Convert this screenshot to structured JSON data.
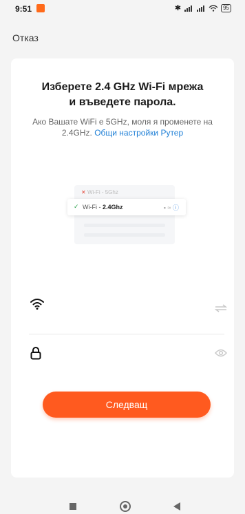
{
  "status_bar": {
    "time": "9:51",
    "battery": "95",
    "icons": [
      "bluetooth-icon",
      "signal-icon",
      "signal-icon",
      "wifi-icon",
      "battery-icon"
    ]
  },
  "header": {
    "cancel_label": "Отказ"
  },
  "card": {
    "title_line1": "Изберете 2.4 GHz Wi-Fi мрежа",
    "title_line2": "и въведете парола.",
    "subtitle_text": "Ако Вашате WiFi е 5GHz, моля я променете на 2.4GHz. ",
    "subtitle_link": "Общи настройки Рутер"
  },
  "illustration": {
    "row1_prefix": "Wi-Fi - ",
    "row1_band": "5Ghz",
    "row2_prefix": "Wi-Fi - ",
    "row2_band": "2.4Ghz"
  },
  "form": {
    "wifi_icon": "wifi-icon",
    "swap_icon": "swap-icon",
    "lock_icon": "lock-icon",
    "eye_icon": "eye-icon"
  },
  "buttons": {
    "next_label": "Следващ"
  },
  "colors": {
    "accent": "#ff5a1f",
    "link": "#1e7fd6",
    "check": "#2ea44f",
    "close": "#e23c2c"
  }
}
